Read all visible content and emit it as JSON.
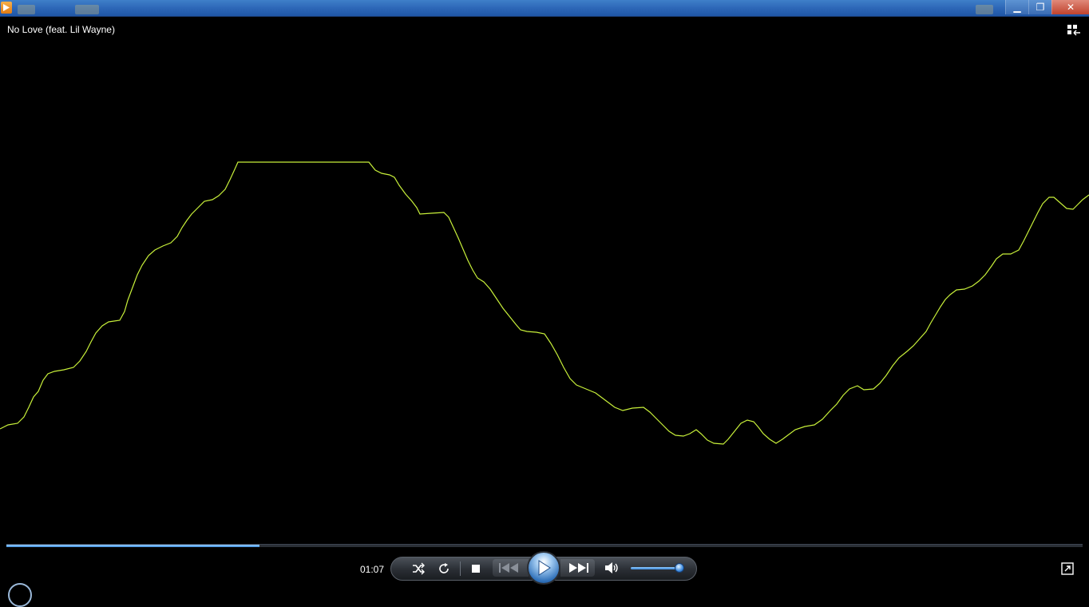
{
  "window": {
    "minimize_glyph": "▁",
    "restore_glyph": "❐",
    "close_glyph": "✕"
  },
  "now_playing": {
    "title": "No Love (feat. Lil Wayne)",
    "elapsed": "01:07",
    "progress_fraction": 0.235
  },
  "volume": {
    "level_fraction": 0.95
  },
  "visualization": {
    "line_color": "#c8f03a",
    "background": "#000000"
  },
  "icons": {
    "shuffle": "shuffle-icon",
    "repeat": "repeat-icon",
    "stop": "stop-icon",
    "previous": "previous-icon",
    "play": "play-icon",
    "next": "next-icon",
    "mute": "speaker-icon",
    "fullscreen": "fullscreen-icon",
    "switch_library": "switch-to-library-icon"
  },
  "colors": {
    "accent": "#3f8fe0",
    "titlebar": "#2d67b7"
  }
}
